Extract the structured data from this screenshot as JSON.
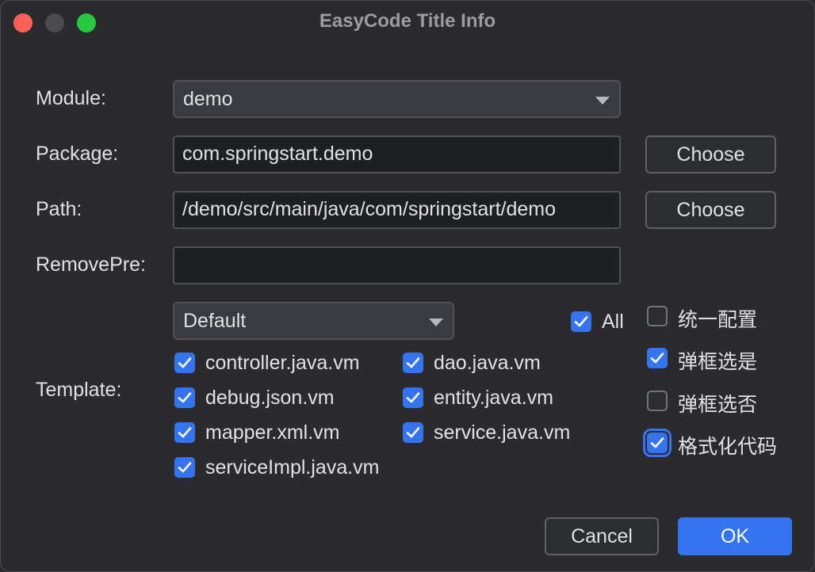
{
  "window": {
    "title": "EasyCode Title Info"
  },
  "form": {
    "module": {
      "label": "Module:",
      "value": "demo"
    },
    "package": {
      "label": "Package:",
      "value": "com.springstart.demo",
      "button": "Choose"
    },
    "path": {
      "label": "Path:",
      "value": "/demo/src/main/java/com/springstart/demo",
      "button": "Choose"
    },
    "remove_pre": {
      "label": "RemovePre:",
      "value": ""
    },
    "template": {
      "label": "Template:",
      "group": "Default",
      "all": {
        "label": "All",
        "checked": true
      },
      "items": [
        {
          "label": "controller.java.vm",
          "checked": true
        },
        {
          "label": "dao.java.vm",
          "checked": true
        },
        {
          "label": "debug.json.vm",
          "checked": true
        },
        {
          "label": "entity.java.vm",
          "checked": true
        },
        {
          "label": "mapper.xml.vm",
          "checked": true
        },
        {
          "label": "service.java.vm",
          "checked": true
        },
        {
          "label": "serviceImpl.java.vm",
          "checked": true
        }
      ]
    },
    "options": [
      {
        "label": "统一配置",
        "checked": false
      },
      {
        "label": "弹框选是",
        "checked": true
      },
      {
        "label": "弹框选否",
        "checked": false
      },
      {
        "label": "格式化代码",
        "checked": true
      }
    ]
  },
  "footer": {
    "cancel": "Cancel",
    "ok": "OK"
  },
  "colors": {
    "accent": "#3574f0",
    "background": "#2b2b2d",
    "close": "#ff5f57",
    "maximize": "#28c840"
  }
}
